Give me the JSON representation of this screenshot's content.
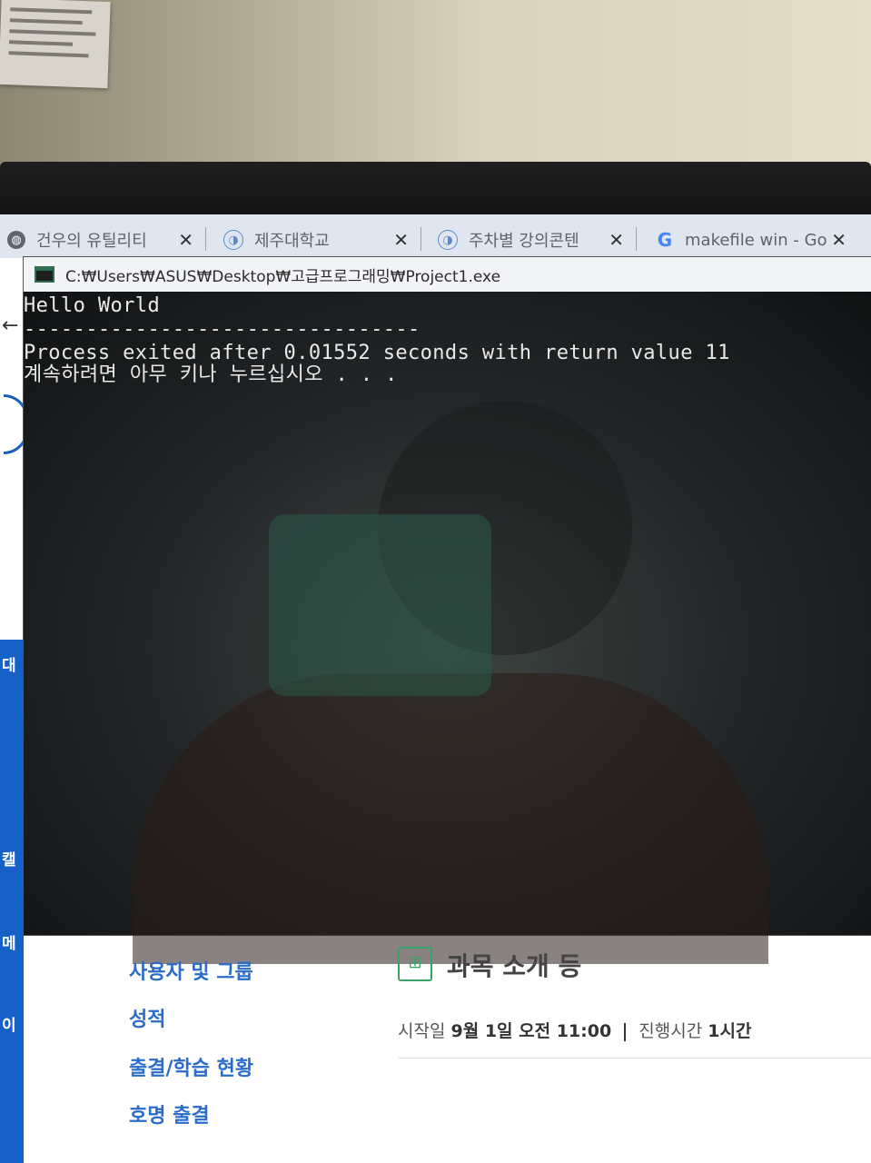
{
  "browser": {
    "tabs": [
      {
        "label": "건우의 유틸리티",
        "icon": "globe-icon"
      },
      {
        "label": "제주대학교",
        "icon": "site-icon"
      },
      {
        "label": "주차별 강의콘텐",
        "icon": "site-icon"
      },
      {
        "label": "makefile win - Go",
        "icon": "google-icon"
      }
    ],
    "close_glyph": "✕"
  },
  "console": {
    "title": "C:₩Users₩ASUS₩Desktop₩고급프로그래밍₩Project1.exe",
    "lines": [
      "Hello World",
      "--------------------------------",
      "Process exited after 0.01552 seconds with return value 11",
      "계속하려면 아무 키나 누르십시오 . . ."
    ]
  },
  "sidebar_fragments": [
    "대",
    "캘",
    "메",
    "이"
  ],
  "page": {
    "menu": [
      "사용자 및 그룹",
      "성적",
      "출결/학습 현황",
      "호명 출결"
    ],
    "course_title": "과목 소개 등",
    "course_meta": {
      "start_label": "시작일",
      "start_value": "9월 1일 오전 11:00",
      "duration_label": "진행시간",
      "duration_value": "1시간"
    }
  },
  "colors": {
    "console_bg": "#0c0c0c",
    "console_text": "#e9e9e9",
    "link_blue": "#2a6cc9",
    "sidebar_blue": "#1561c7",
    "course_icon_green": "#3aa36a"
  }
}
